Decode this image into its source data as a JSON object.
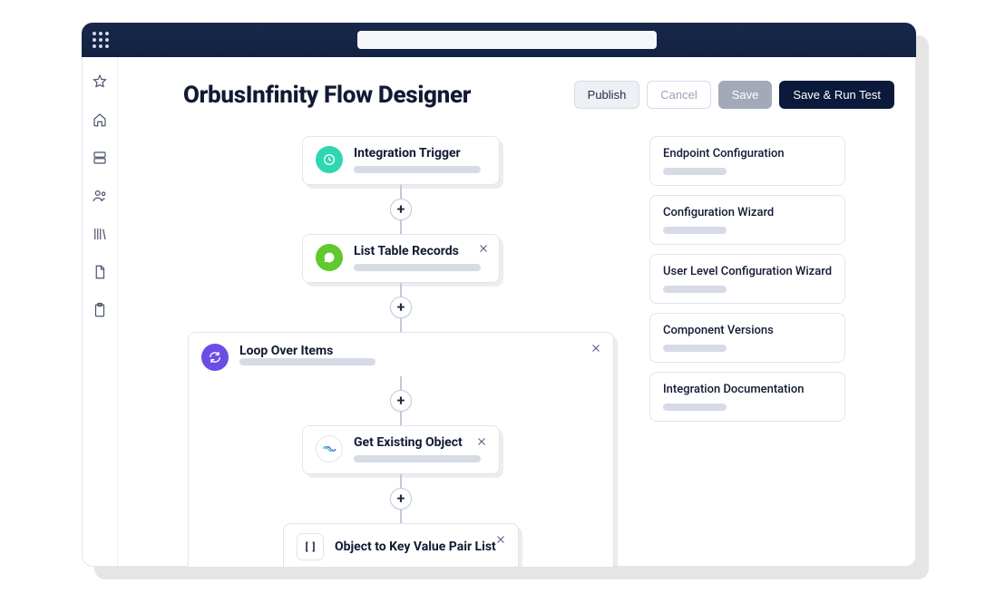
{
  "header": {
    "title": "OrbusInfinity Flow Designer",
    "actions": {
      "publish": "Publish",
      "cancel": "Cancel",
      "save": "Save",
      "save_run": "Save & Run Test"
    }
  },
  "flow": {
    "nodes": [
      {
        "id": "trigger",
        "title": "Integration Trigger",
        "icon": "clock",
        "closable": false
      },
      {
        "id": "list",
        "title": "List Table Records",
        "icon": "chat",
        "closable": true
      },
      {
        "id": "loop",
        "title": "Loop Over Items",
        "icon": "refresh",
        "closable": true
      },
      {
        "id": "get",
        "title": "Get Existing Object",
        "icon": "infinity",
        "closable": true
      },
      {
        "id": "kvp",
        "title": "Object to Key Value Pair List",
        "icon": "brackets",
        "closable": true
      }
    ]
  },
  "side_panels": [
    {
      "title": "Endpoint Configuration"
    },
    {
      "title": "Configuration Wizard"
    },
    {
      "title": "User Level Configuration Wizard"
    },
    {
      "title": "Component Versions"
    },
    {
      "title": "Integration Documentation"
    }
  ],
  "sidebar_icons": [
    "star",
    "home",
    "server",
    "users",
    "library",
    "document",
    "clipboard"
  ]
}
